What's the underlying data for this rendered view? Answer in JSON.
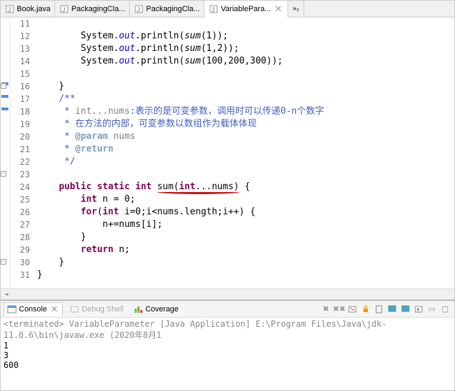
{
  "tabs": [
    {
      "label": "Book.java"
    },
    {
      "label": "PackagingCla..."
    },
    {
      "label": "PackagingCla..."
    },
    {
      "label": "VariablePara...",
      "active": true
    }
  ],
  "more_tabs": "»₂",
  "code": {
    "line_start": 11,
    "lines": [
      "        System.out.println(sum(1));",
      "        System.out.println(sum(1,2));",
      "        System.out.println(sum(100,200,300));",
      "",
      "    }",
      "    /**",
      "     * int...nums:表示的是可变参数，调用时可以传递0-n个数字",
      "     * 在方法的内部，可变参数以数组作为载体体现",
      "     * @param nums",
      "     * @return",
      "     */",
      "",
      "    public static int sum(int...nums) {",
      "        int n = 0;",
      "        for(int i=0;i<nums.length;i++) {",
      "            n+=nums[i];",
      "        }",
      "        return n;",
      "    }",
      "}",
      ""
    ],
    "highlight_line": 18,
    "method_name": "sum",
    "varargs": "int...nums"
  },
  "console": {
    "tabs": {
      "console": "Console",
      "debug": "Debug Shell",
      "coverage": "Coverage"
    },
    "terminated": "<terminated> VariableParameter [Java Application] E:\\Program Files\\Java\\jdk-11.0.6\\bin\\javaw.exe (2020年8月1",
    "output": [
      "1",
      "3",
      "600"
    ]
  }
}
